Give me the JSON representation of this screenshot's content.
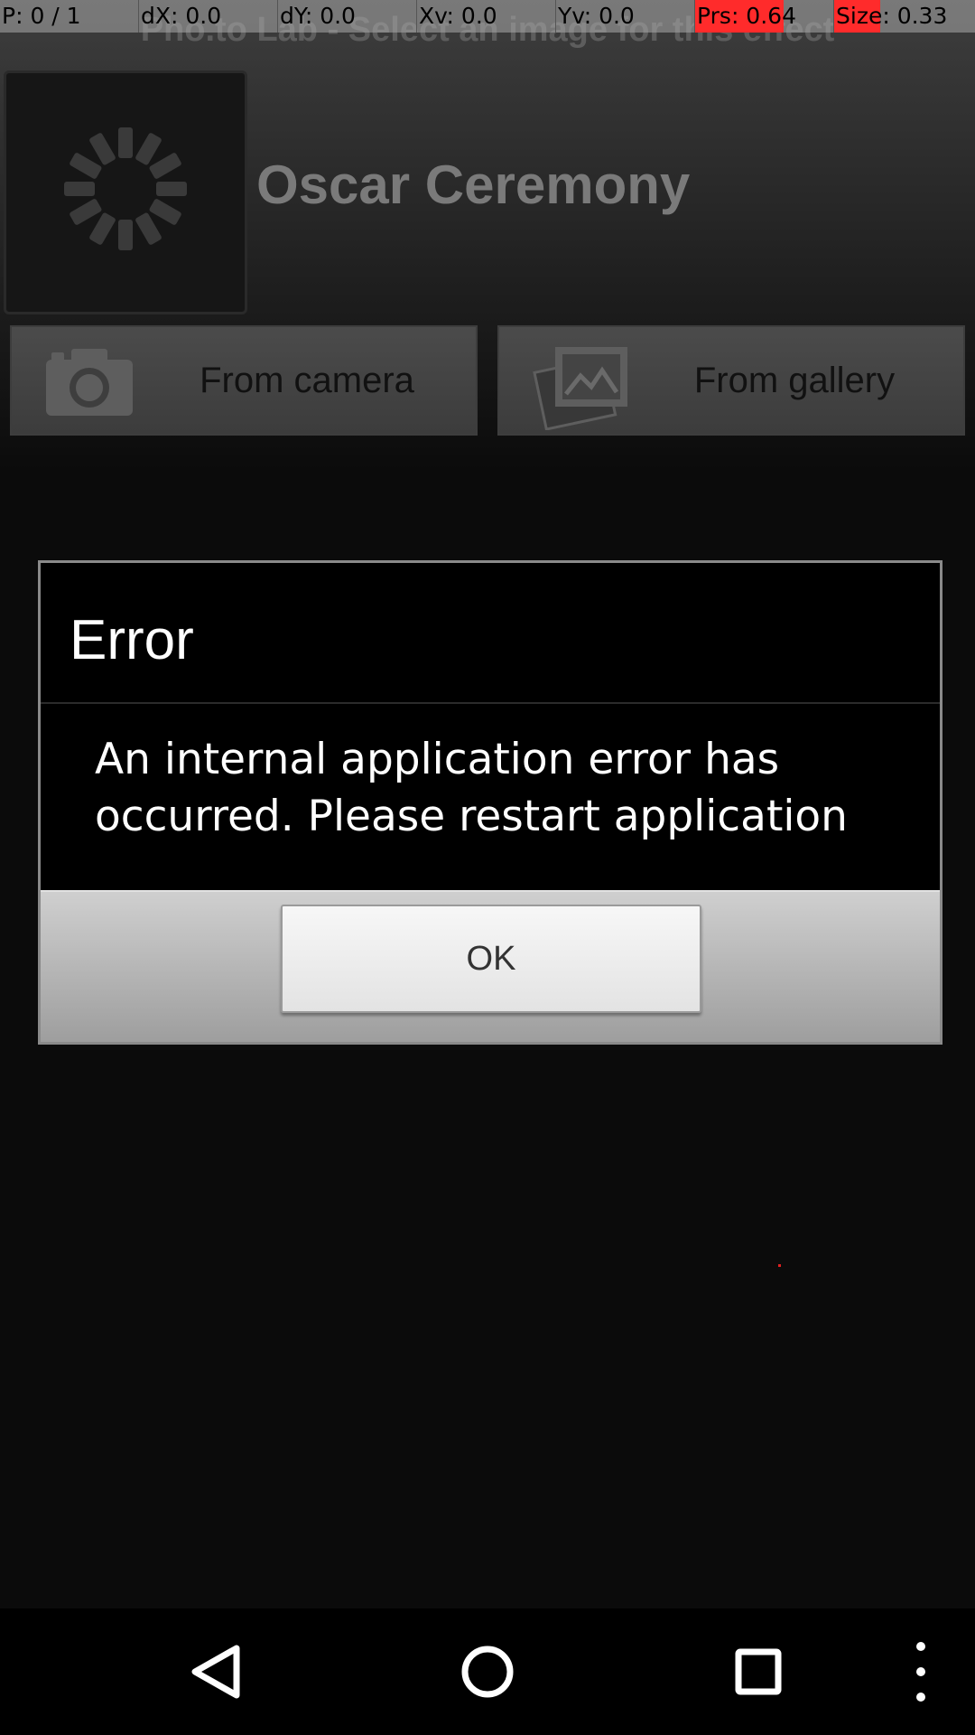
{
  "debug": {
    "pointer": "P: 0 / 1",
    "dx": "dX: 0.0",
    "dy": "dY: 0.0",
    "xv": "Xv: 0.0",
    "yv": "Yv: 0.0",
    "prs": "Prs: 0.64",
    "size": "Size: 0.33",
    "prs_level": 0.64,
    "size_level": 0.33,
    "alert_color": "#ff2b2b"
  },
  "app": {
    "title": "Pho.to Lab - Select an image for this effect",
    "effect_name": "Oscar Ceremony",
    "thumbnail_icon": "loading-spinner-icon",
    "buttons": [
      {
        "label": "From camera",
        "icon": "camera-icon"
      },
      {
        "label": "From gallery",
        "icon": "gallery-icon"
      }
    ]
  },
  "dialog": {
    "title": "Error",
    "message": "An internal application error has occurred. Please restart application",
    "ok_label": "OK"
  },
  "nav": {
    "back_icon": "back-icon",
    "home_icon": "home-icon",
    "recents_icon": "recents-icon",
    "menu_icon": "overflow-menu-icon"
  }
}
